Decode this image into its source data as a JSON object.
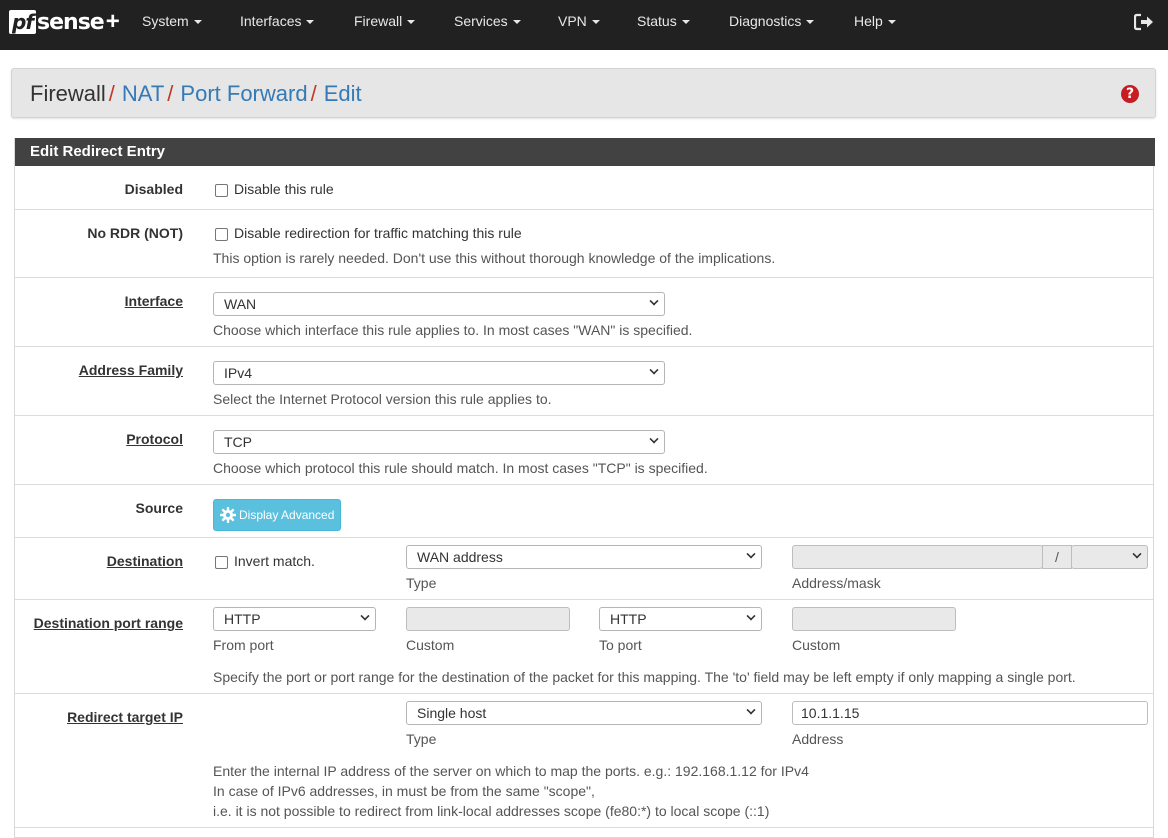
{
  "nav": {
    "brand_pf": "pf",
    "brand_sense": "sense",
    "brand_plus": "+",
    "items": [
      {
        "label": "System"
      },
      {
        "label": "Interfaces"
      },
      {
        "label": "Firewall"
      },
      {
        "label": "Services"
      },
      {
        "label": "VPN"
      },
      {
        "label": "Status"
      },
      {
        "label": "Diagnostics"
      },
      {
        "label": "Help"
      }
    ]
  },
  "breadcrumb": {
    "root": "Firewall",
    "sep": "/",
    "links": [
      "NAT",
      "Port Forward",
      "Edit"
    ]
  },
  "help_icon_glyph": "?",
  "panel": {
    "title": "Edit Redirect Entry",
    "disabled": {
      "label": "Disabled",
      "checkbox_label": "Disable this rule",
      "checked": false
    },
    "nordr": {
      "label": "No RDR (NOT)",
      "checkbox_label": "Disable redirection for traffic matching this rule",
      "help": "This option is rarely needed. Don't use this without thorough knowledge of the implications.",
      "checked": false
    },
    "interface": {
      "label": "Interface",
      "value": "WAN",
      "help": "Choose which interface this rule applies to. In most cases \"WAN\" is specified."
    },
    "address_family": {
      "label": "Address Family",
      "value": "IPv4",
      "help": "Select the Internet Protocol version this rule applies to."
    },
    "protocol": {
      "label": "Protocol",
      "value": "TCP",
      "help": "Choose which protocol this rule should match. In most cases \"TCP\" is specified."
    },
    "source": {
      "label": "Source",
      "button": "Display Advanced"
    },
    "destination": {
      "label": "Destination",
      "invert_label": "Invert match.",
      "type_value": "WAN address",
      "type_caption": "Type",
      "mask_sep": "/",
      "mask_caption": "Address/mask"
    },
    "dest_port": {
      "label": "Destination port range",
      "from_value": "HTTP",
      "from_caption": "From port",
      "custom_caption": "Custom",
      "to_value": "HTTP",
      "to_caption": "To port",
      "custom2_caption": "Custom",
      "help": "Specify the port or port range for the destination of the packet for this mapping. The 'to' field may be left empty if only mapping a single port."
    },
    "redirect_ip": {
      "label": "Redirect target IP",
      "type_value": "Single host",
      "type_caption": "Type",
      "address_value": "10.1.1.15",
      "address_caption": "Address",
      "help1": "Enter the internal IP address of the server on which to map the ports. e.g.: 192.168.1.12 for IPv4",
      "help2": "In case of IPv6 addresses, in must be from the same \"scope\",",
      "help3": "i.e. it is not possible to redirect from link-local addresses scope (fe80:*) to local scope (::1)"
    }
  }
}
